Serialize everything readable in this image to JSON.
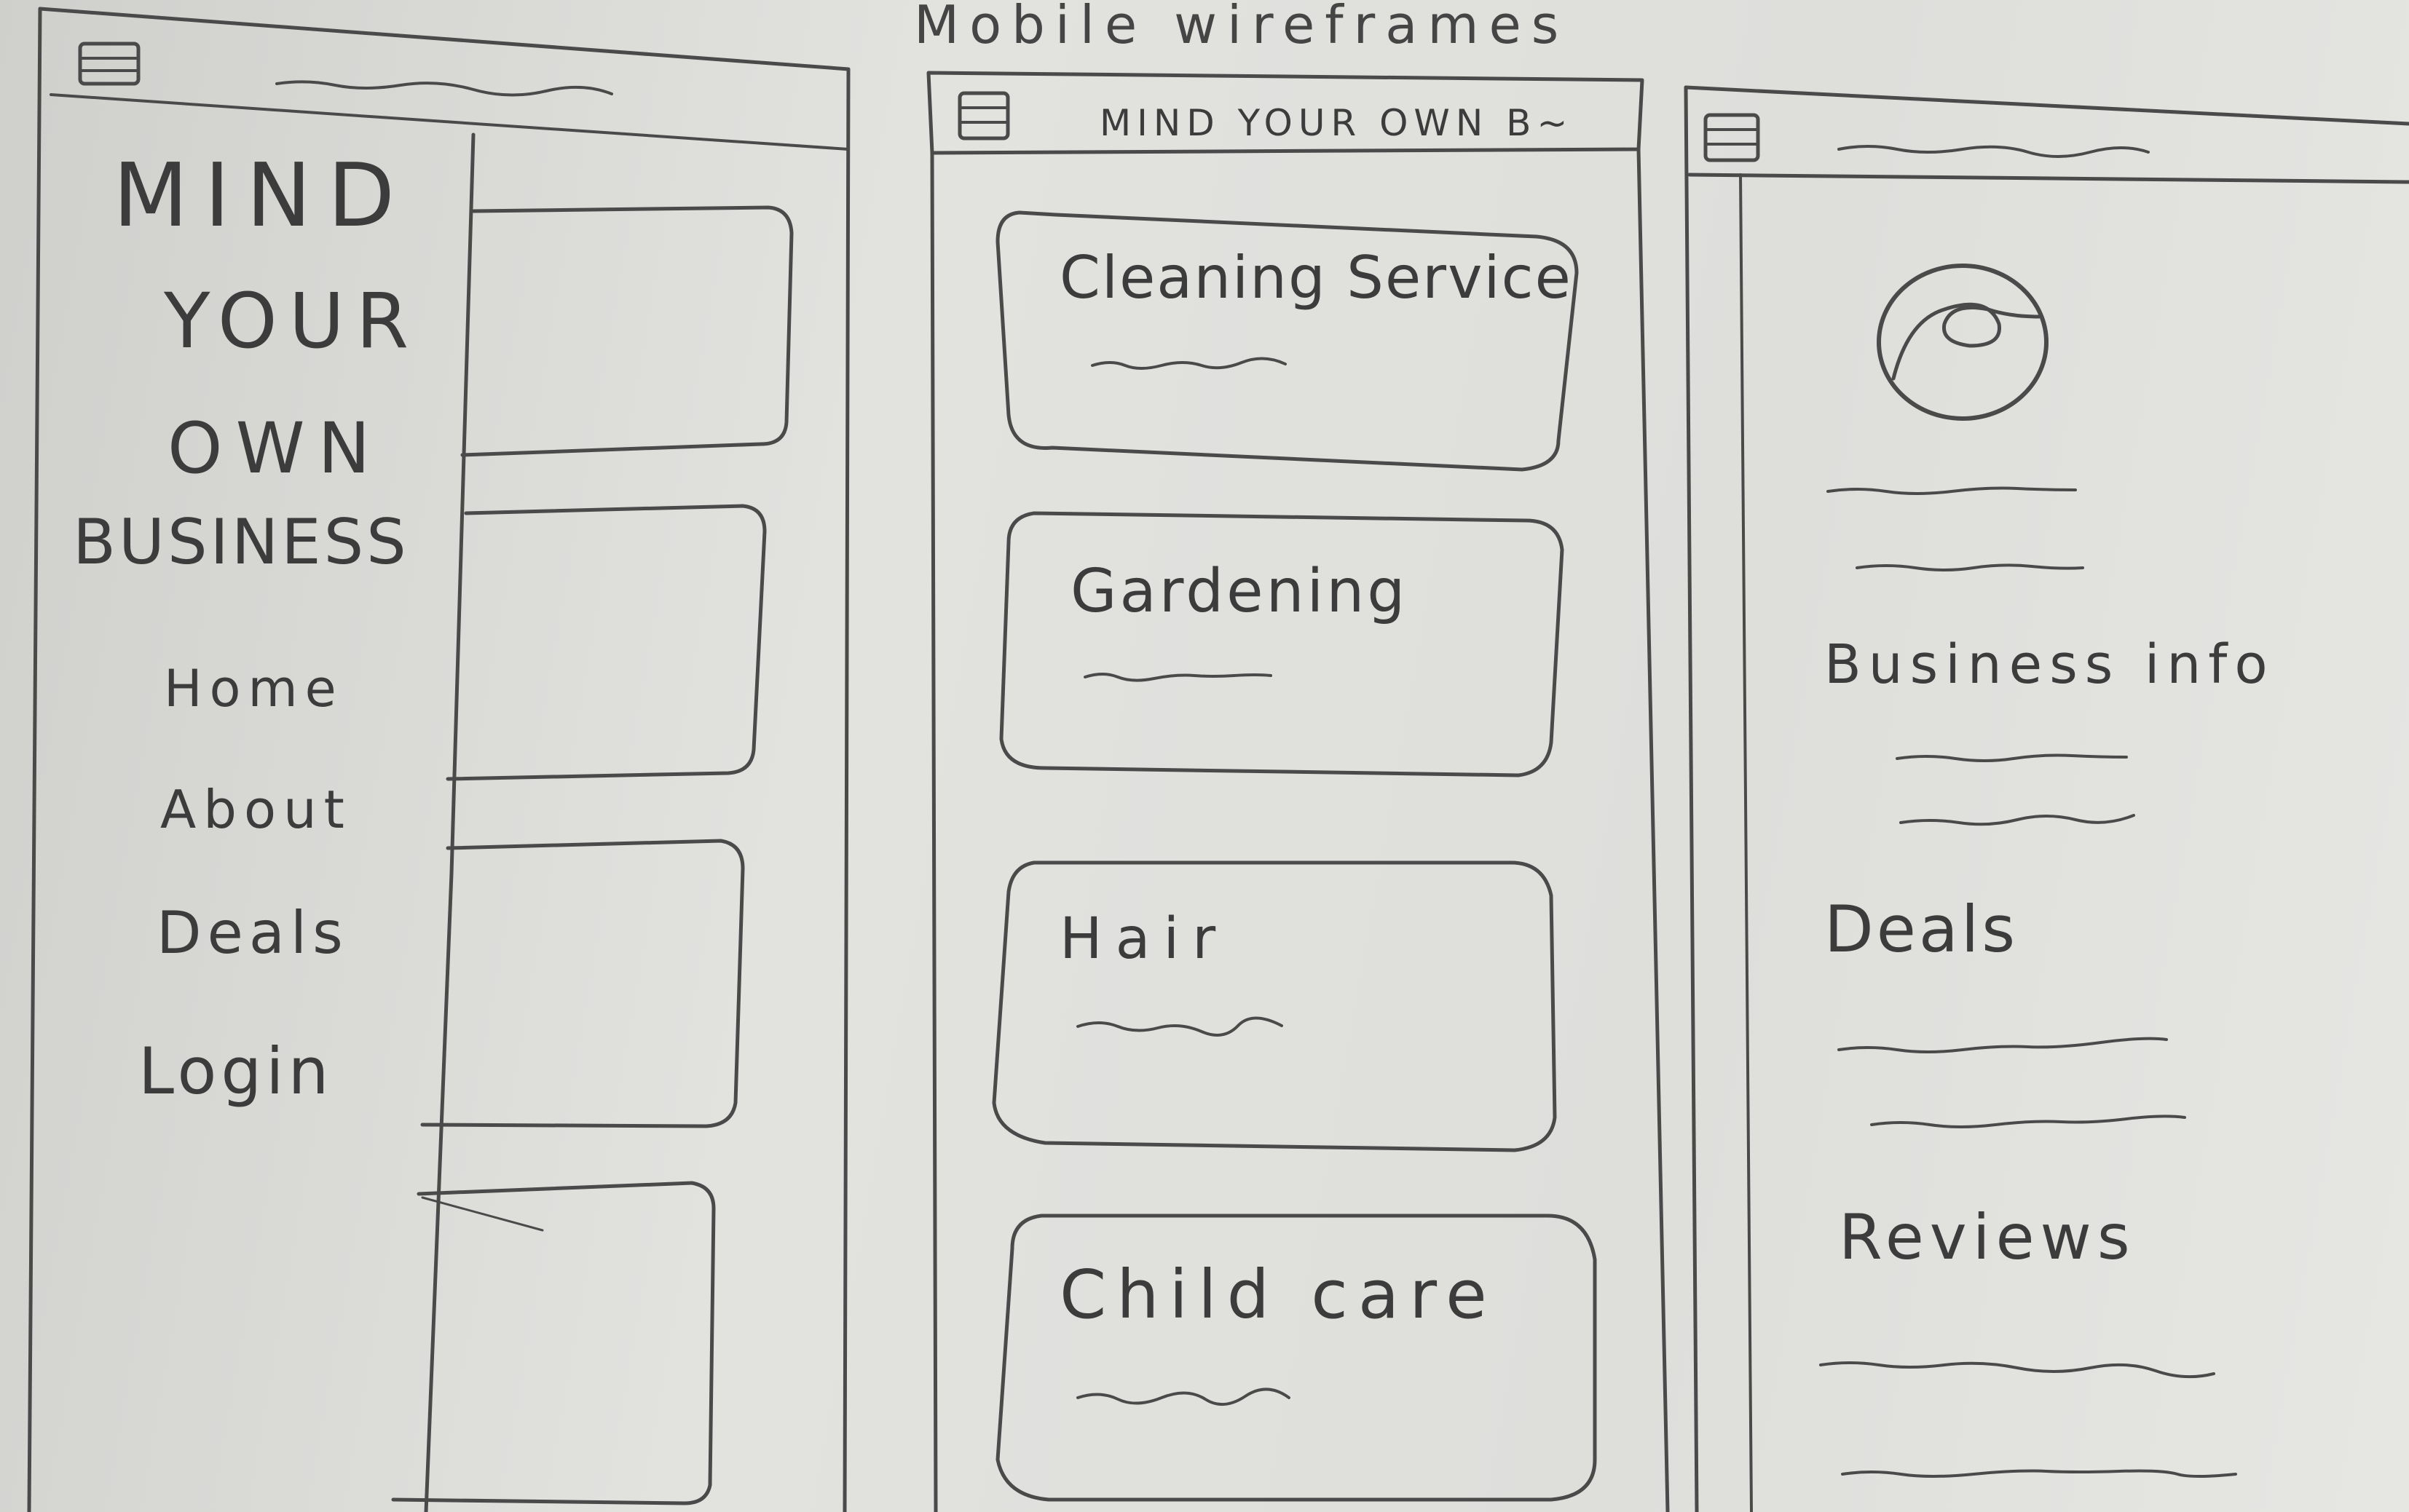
{
  "page_title": "Mobile wireframes",
  "screen1": {
    "brand_lines": [
      "MIND",
      "YOUR",
      "OWN",
      "BUSINESS"
    ],
    "menu": [
      "Home",
      "About",
      "Deals",
      "Login"
    ]
  },
  "screen2": {
    "header_title": "MIND YOUR OWN B~",
    "cards": [
      {
        "title": "Cleaning Service"
      },
      {
        "title": "Gardening"
      },
      {
        "title": "Hair"
      },
      {
        "title": "Child care"
      }
    ]
  },
  "screen3": {
    "sections": [
      "Business info",
      "Deals",
      "Reviews"
    ]
  }
}
